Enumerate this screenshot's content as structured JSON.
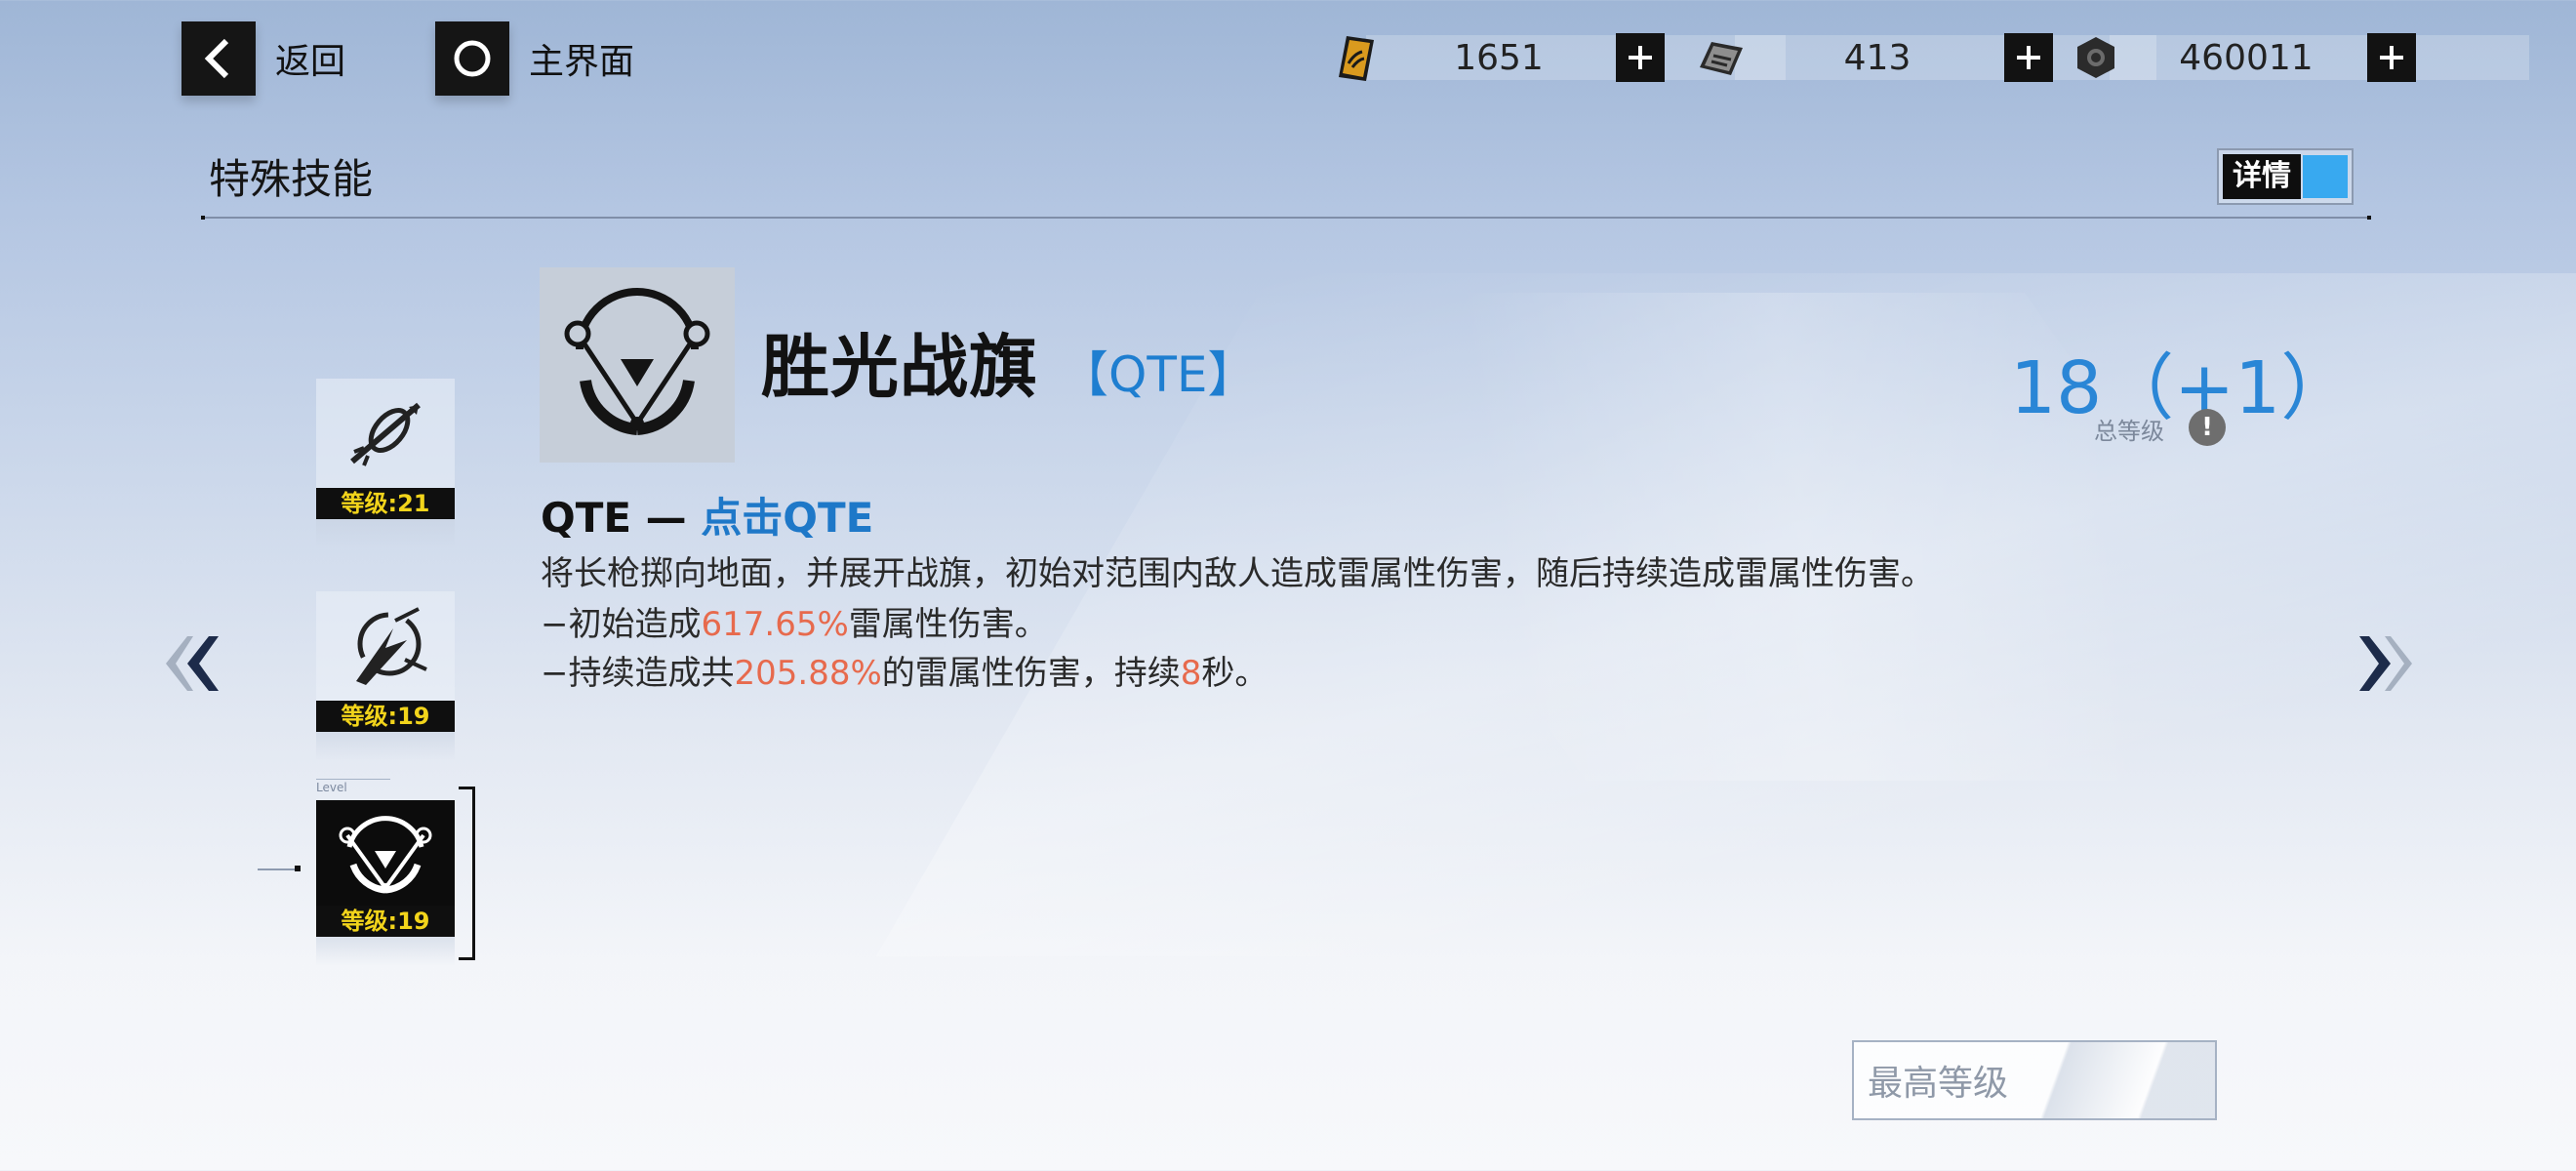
{
  "topbar": {
    "back_label": "返回",
    "home_label": "主界面",
    "resources": [
      {
        "icon": "gold-ticket-icon",
        "value": "1651"
      },
      {
        "icon": "chip-card-icon",
        "value": "413"
      },
      {
        "icon": "hex-nut-icon",
        "value": "460011"
      }
    ],
    "plus_glyph": "+"
  },
  "header": {
    "title": "特殊技能",
    "detail_toggle_label": "详情"
  },
  "skill_list": [
    {
      "icon": "spear-ring-skill-icon",
      "level_label": "等级:21",
      "selected": false
    },
    {
      "icon": "lightning-strike-skill-icon",
      "level_label": "等级:19",
      "selected": false
    },
    {
      "icon": "battle-flag-skill-icon",
      "level_label": "等级:19",
      "selected": true
    }
  ],
  "selected_level_caption": "Level",
  "skill": {
    "name": "胜光战旗",
    "type": "【QTE】",
    "total_level": "18（+1）",
    "total_level_label": "总等级",
    "info_glyph": "!",
    "heading_prefix": "QTE — ",
    "heading_highlight": "点击QTE",
    "desc_line1": "将长枪掷向地面，并展开战旗，初始对范围内敌人造成雷属性伤害，随后持续造成雷属性伤害。",
    "desc_line2_pre": "−初始造成",
    "desc_line2_num": "617.65%",
    "desc_line2_post": "雷属性伤害。",
    "desc_line3_pre": "−持续造成共",
    "desc_line3_num": "205.88%",
    "desc_line3_mid": "的雷属性伤害，持续",
    "desc_line3_num2": "8",
    "desc_line3_post": "秒。"
  },
  "max_level_label": "最高等级",
  "colors": {
    "accent_blue": "#1e78c8",
    "value_red": "#e76a4d",
    "level_yellow": "#f2d41b",
    "toggle_blue": "#38a9f0"
  }
}
